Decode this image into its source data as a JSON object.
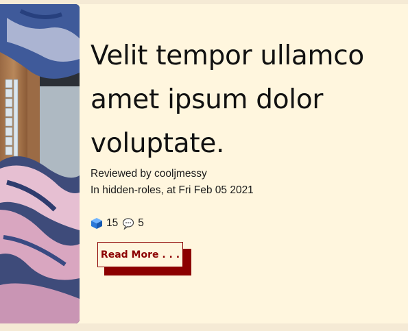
{
  "post": {
    "title": "Velit tempor ullamco amet ipsum dolor voluptate.",
    "reviewed_line": "Reviewed by cooljmessy",
    "category_line": "In hidden-roles, at Fri Feb 05 2021",
    "stats": {
      "likes_icon": "blue-cube-icon",
      "likes_count": "15",
      "comments_icon": "speech-bubble-icon",
      "comments_count": "5"
    },
    "read_more_label": "Read More . . ."
  },
  "colors": {
    "card_background": "#fff6de",
    "page_background": "#f5ead5",
    "accent": "#8c0000"
  }
}
